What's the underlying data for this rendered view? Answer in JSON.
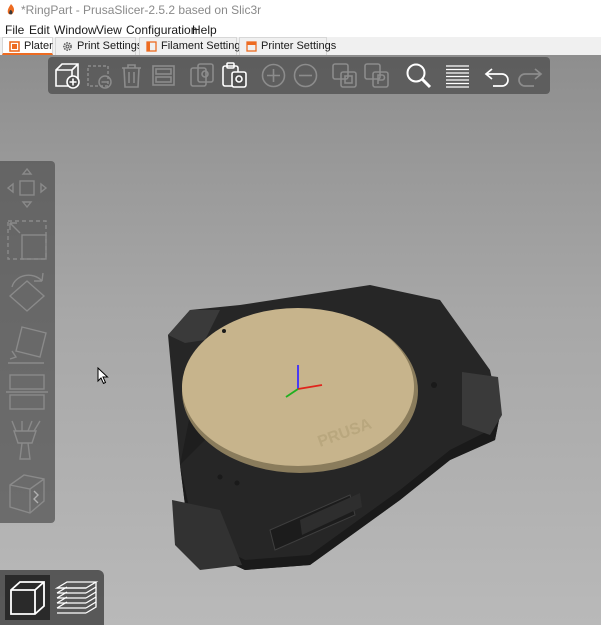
{
  "window": {
    "title": "*RingPart - PrusaSlicer-2.5.2 based on Slic3r",
    "icon": "prusa-logo-icon"
  },
  "menu": {
    "items": [
      "File",
      "Edit",
      "Window",
      "View",
      "Configuration",
      "Help"
    ]
  },
  "tabs": [
    {
      "label": "Plater",
      "icon": "plater-icon",
      "active": true
    },
    {
      "label": "Print Settings",
      "icon": "cog-icon",
      "active": false
    },
    {
      "label": "Filament Settings",
      "icon": "spool-icon",
      "active": false
    },
    {
      "label": "Printer Settings",
      "icon": "printer-icon",
      "active": false
    }
  ],
  "top_toolbar": {
    "buttons": [
      {
        "name": "add",
        "icon": "add-cube-icon",
        "enabled": true
      },
      {
        "name": "delete",
        "icon": "delete-icon",
        "enabled": false
      },
      {
        "name": "delete-all",
        "icon": "trash-icon",
        "enabled": false
      },
      {
        "name": "arrange",
        "icon": "arrange-icon",
        "enabled": false
      },
      {
        "name": "copy",
        "icon": "copy-icon",
        "enabled": false
      },
      {
        "name": "paste",
        "icon": "paste-icon",
        "enabled": true
      },
      {
        "name": "add-instance",
        "icon": "plus-circle-icon",
        "enabled": false
      },
      {
        "name": "remove-instance",
        "icon": "minus-circle-icon",
        "enabled": false
      },
      {
        "name": "split-objects",
        "icon": "split-objects-icon",
        "enabled": false
      },
      {
        "name": "split-parts",
        "icon": "split-parts-icon",
        "enabled": false
      },
      {
        "name": "search",
        "icon": "search-icon",
        "enabled": true
      },
      {
        "name": "layers-editing",
        "icon": "layers-icon",
        "enabled": true
      },
      {
        "name": "undo",
        "icon": "undo-icon",
        "enabled": true
      },
      {
        "name": "redo",
        "icon": "redo-icon",
        "enabled": false
      }
    ]
  },
  "left_toolbar": {
    "tools": [
      {
        "name": "move",
        "icon": "move-icon"
      },
      {
        "name": "scale",
        "icon": "scale-icon"
      },
      {
        "name": "rotate",
        "icon": "rotate-icon"
      },
      {
        "name": "place-on-face",
        "icon": "place-on-face-icon"
      },
      {
        "name": "cut",
        "icon": "cut-icon"
      },
      {
        "name": "paint-supports",
        "icon": "paint-supports-icon"
      },
      {
        "name": "seam",
        "icon": "seam-cube-icon"
      }
    ]
  },
  "view_toggle": {
    "items": [
      {
        "name": "3d-view",
        "icon": "cube-view-icon",
        "active": true
      },
      {
        "name": "preview",
        "icon": "layers-preview-icon",
        "active": false
      }
    ]
  },
  "bed_label": "PRUSA",
  "colors": {
    "accent": "#ed6b21",
    "bed": "#c7b48c",
    "part": "#2b2b2b"
  }
}
